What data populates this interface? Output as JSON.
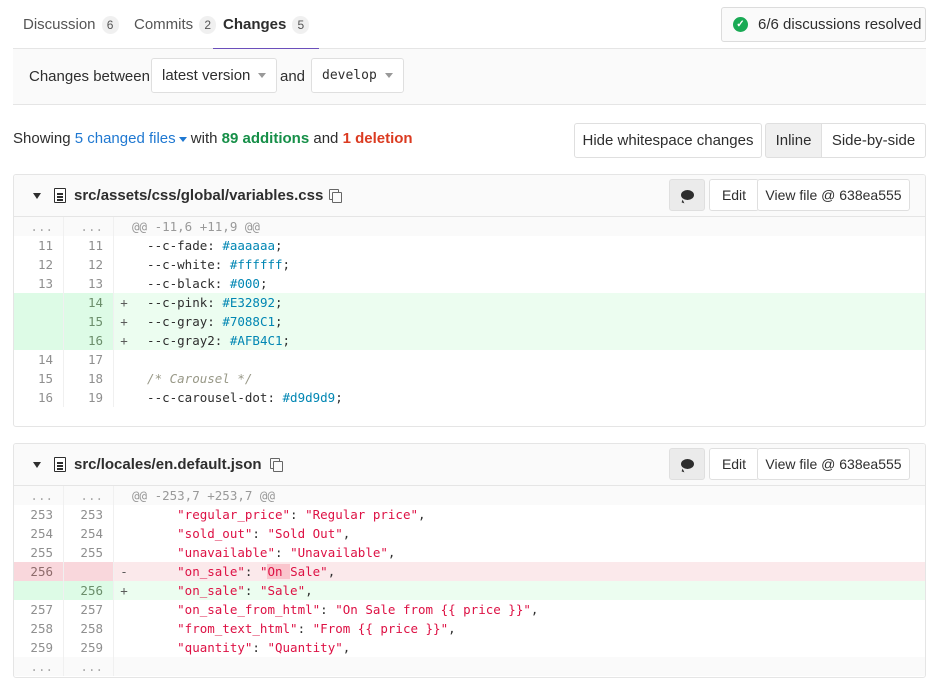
{
  "tabs": [
    {
      "label": "Discussion",
      "count": "6"
    },
    {
      "label": "Commits",
      "count": "2"
    },
    {
      "label": "Changes",
      "count": "5"
    }
  ],
  "resolved": {
    "text": "6/6 discussions resolved"
  },
  "compare": {
    "prefix": "Changes between",
    "from": "latest version",
    "and": "and",
    "to": "develop"
  },
  "summary": {
    "showing": "Showing",
    "files": "5 changed files",
    "with": "with",
    "additions": "89 additions",
    "and": "and",
    "deletions": "1 deletion"
  },
  "view_buttons": {
    "whitespace": "Hide whitespace changes",
    "inline": "Inline",
    "side": "Side-by-side"
  },
  "files": [
    {
      "path": "src/assets/css/global/variables.css",
      "edit": "Edit",
      "view": "View file @ 638ea555",
      "lines": [
        {
          "type": "match",
          "old": "...",
          "new": "...",
          "sign": "",
          "code": "@@ -11,6 +11,9 @@"
        },
        {
          "type": "ctx",
          "old": "11",
          "new": "11",
          "sign": "",
          "prop": "  --c-fade: ",
          "val": "#aaaaaa",
          "end": ";"
        },
        {
          "type": "ctx",
          "old": "12",
          "new": "12",
          "sign": "",
          "prop": "  --c-white: ",
          "val": "#ffffff",
          "end": ";"
        },
        {
          "type": "ctx",
          "old": "13",
          "new": "13",
          "sign": "",
          "prop": "  --c-black: ",
          "val": "#000",
          "end": ";"
        },
        {
          "type": "add",
          "old": "",
          "new": "14",
          "sign": "+",
          "prop": "  --c-pink: ",
          "val": "#E32892",
          "end": ";"
        },
        {
          "type": "add",
          "old": "",
          "new": "15",
          "sign": "+",
          "prop": "  --c-gray: ",
          "val": "#7088C1",
          "end": ";"
        },
        {
          "type": "add",
          "old": "",
          "new": "16",
          "sign": "+",
          "prop": "  --c-gray2: ",
          "val": "#AFB4C1",
          "end": ";"
        },
        {
          "type": "ctx",
          "old": "14",
          "new": "17",
          "sign": "",
          "prop": "",
          "val": "",
          "end": ""
        },
        {
          "type": "ctx",
          "old": "15",
          "new": "18",
          "sign": "",
          "comment": "  /* Carousel */"
        },
        {
          "type": "ctx",
          "old": "16",
          "new": "19",
          "sign": "",
          "prop": "  --c-carousel-dot: ",
          "val": "#d9d9d9",
          "end": ";"
        }
      ]
    },
    {
      "path": "src/locales/en.default.json",
      "edit": "Edit",
      "view": "View file @ 638ea555",
      "lines": [
        {
          "type": "match",
          "old": "...",
          "new": "...",
          "sign": "",
          "code": "@@ -253,7 +253,7 @@"
        },
        {
          "type": "ctx",
          "old": "253",
          "new": "253",
          "sign": "",
          "key": "      \"regular_price\"",
          "sep": ": ",
          "str": "\"Regular price\"",
          "end": ","
        },
        {
          "type": "ctx",
          "old": "254",
          "new": "254",
          "sign": "",
          "key": "      \"sold_out\"",
          "sep": ": ",
          "str": "\"Sold Out\"",
          "end": ","
        },
        {
          "type": "ctx",
          "old": "255",
          "new": "255",
          "sign": "",
          "key": "      \"unavailable\"",
          "sep": ": ",
          "str": "\"Unavailable\"",
          "end": ","
        },
        {
          "type": "del",
          "old": "256",
          "new": "",
          "sign": "-",
          "key": "      \"on_sale\"",
          "sep": ": ",
          "str_a": "\"",
          "hl": "On ",
          "str_b": "Sale\"",
          "end": ","
        },
        {
          "type": "add",
          "old": "",
          "new": "256",
          "sign": "+",
          "key": "      \"on_sale\"",
          "sep": ": ",
          "str": "\"Sale\"",
          "end": ","
        },
        {
          "type": "ctx",
          "old": "257",
          "new": "257",
          "sign": "",
          "key": "      \"on_sale_from_html\"",
          "sep": ": ",
          "str": "\"On Sale from {{ price }}\"",
          "end": ","
        },
        {
          "type": "ctx",
          "old": "258",
          "new": "258",
          "sign": "",
          "key": "      \"from_text_html\"",
          "sep": ": ",
          "str": "\"From {{ price }}\"",
          "end": ","
        },
        {
          "type": "ctx",
          "old": "259",
          "new": "259",
          "sign": "",
          "key": "      \"quantity\"",
          "sep": ": ",
          "str": "\"Quantity\"",
          "end": ","
        },
        {
          "type": "match",
          "old": "...",
          "new": "...",
          "sign": "",
          "code": ""
        }
      ]
    }
  ],
  "colors": {
    "accent": "#6b4fbb",
    "link": "#1f78d1",
    "additions": "#168f48",
    "deletions": "#db3b21",
    "resolved_icon": "#1aaa55"
  },
  "icons": {
    "resolved": "check-circle-icon",
    "file": "document-icon",
    "copy": "copy-icon",
    "comment": "comment-icon",
    "collapse": "chevron-down-icon"
  }
}
